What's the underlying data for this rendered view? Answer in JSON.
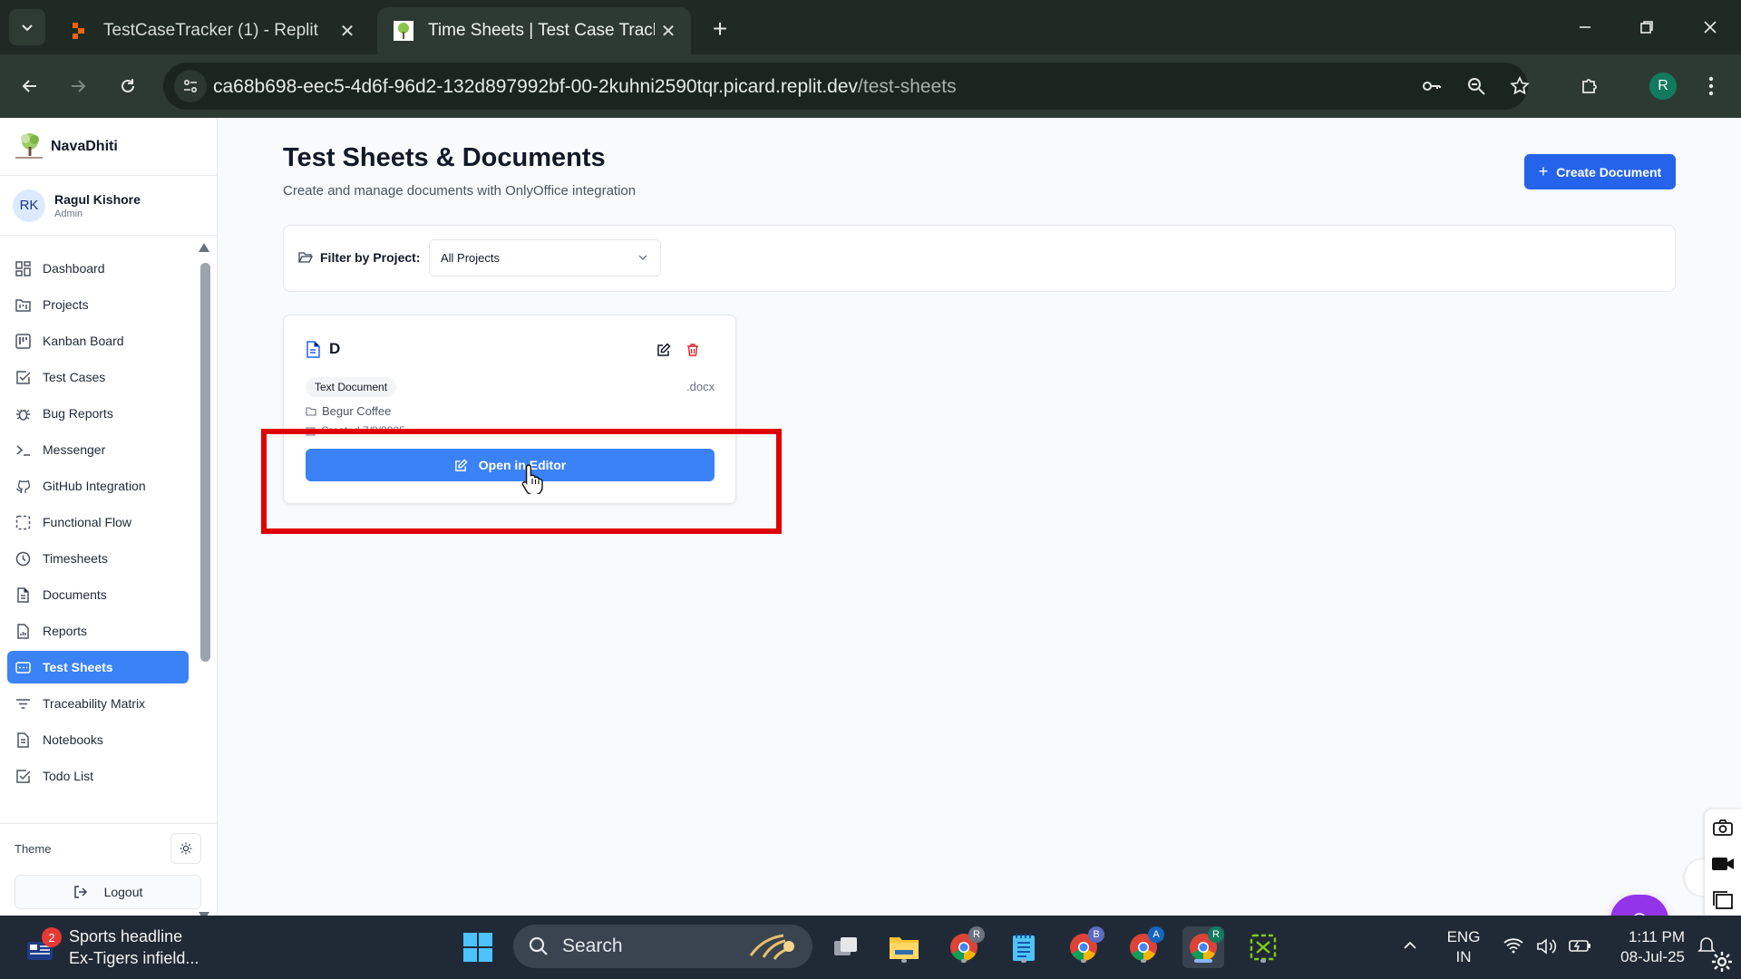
{
  "browser": {
    "tabs": [
      {
        "title": "TestCaseTracker (1) - Replit",
        "active": false
      },
      {
        "title": "Time Sheets | Test Case Tracker",
        "active": true
      }
    ],
    "url_host": "ca68b698-eec5-4d6f-96d2-132d897992bf-00-2kuhni2590tqr.picard.replit.dev",
    "url_path": "/test-sheets",
    "profile_initial": "R"
  },
  "app": {
    "brand": "NavaDhiti",
    "user": {
      "initials": "RK",
      "name": "Ragul Kishore",
      "role": "Admin"
    },
    "nav": [
      {
        "label": "Dashboard",
        "icon": "dashboard-icon"
      },
      {
        "label": "Projects",
        "icon": "folder-kanban-icon"
      },
      {
        "label": "Kanban Board",
        "icon": "kanban-icon"
      },
      {
        "label": "Test Cases",
        "icon": "check-square-icon"
      },
      {
        "label": "Bug Reports",
        "icon": "bug-icon"
      },
      {
        "label": "Messenger",
        "icon": "terminal-icon"
      },
      {
        "label": "GitHub Integration",
        "icon": "github-icon"
      },
      {
        "label": "Functional Flow",
        "icon": "dashed-square-icon"
      },
      {
        "label": "Timesheets",
        "icon": "clock-icon"
      },
      {
        "label": "Documents",
        "icon": "file-text-icon"
      },
      {
        "label": "Reports",
        "icon": "file-chart-icon"
      },
      {
        "label": "Test Sheets",
        "icon": "spreadsheet-icon",
        "active": true
      },
      {
        "label": "Traceability Matrix",
        "icon": "filter-lines-icon"
      },
      {
        "label": "Notebooks",
        "icon": "notebook-icon"
      },
      {
        "label": "Todo List",
        "icon": "check-square-icon"
      }
    ],
    "theme_label": "Theme",
    "logout_label": "Logout"
  },
  "page": {
    "title": "Test Sheets & Documents",
    "subtitle": "Create and manage documents with OnlyOffice integration",
    "create_label": "Create Document",
    "filter": {
      "label": "Filter by Project:",
      "selected": "All Projects"
    },
    "documents": [
      {
        "name": "D",
        "type": "Text Document",
        "extension": ".docx",
        "project": "Begur Coffee",
        "created": "Created 7/8/2025",
        "open_label": "Open in Editor"
      }
    ]
  },
  "taskbar": {
    "weather_badge": "2",
    "weather_title": "Sports headline",
    "weather_subtitle": "Ex-Tigers infield...",
    "search_placeholder": "Search",
    "lang_top": "ENG",
    "lang_bottom": "IN",
    "time": "1:11 PM",
    "date": "08-Jul-25",
    "chrome_profiles": [
      "R",
      "B",
      "A",
      "R"
    ]
  },
  "colors": {
    "accent": "#3b82f6",
    "create_button": "#2563eb",
    "highlight": "#e10000",
    "chat_fab": "#9333ea",
    "delete": "#dc2626"
  }
}
